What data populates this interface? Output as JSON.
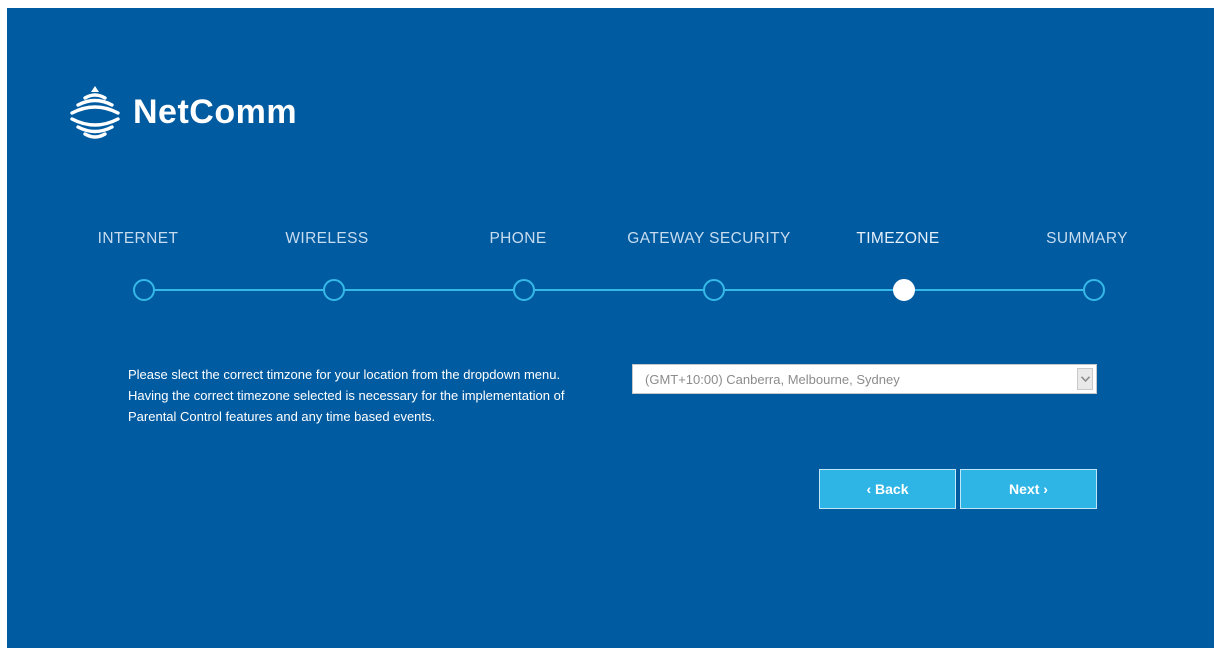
{
  "brand": {
    "logo_text": "NetComm",
    "logo_icon": "wifi-signal-icon"
  },
  "wizard": {
    "steps": [
      {
        "label": "INTERNET",
        "active": false
      },
      {
        "label": "WIRELESS",
        "active": false
      },
      {
        "label": "PHONE",
        "active": false
      },
      {
        "label": "GATEWAY SECURITY",
        "active": false
      },
      {
        "label": "TIMEZONE",
        "active": true
      },
      {
        "label": "SUMMARY",
        "active": false
      }
    ],
    "current_step": "TIMEZONE"
  },
  "timezone": {
    "description": "Please slect the correct timzone for your location from the dropdown menu. Having the correct timezone selected is necessary for the implementation of Parental Control features and any time based events.",
    "selected_value": "(GMT+10:00) Canberra, Melbourne, Sydney",
    "dropdown_icon": "chevron-down-icon"
  },
  "buttons": {
    "back_label": "‹ Back",
    "next_label": "Next ›"
  },
  "colors": {
    "background": "#005ba1",
    "accent": "#35b8e8",
    "button": "#2fb5e5",
    "text": "#ffffff"
  }
}
